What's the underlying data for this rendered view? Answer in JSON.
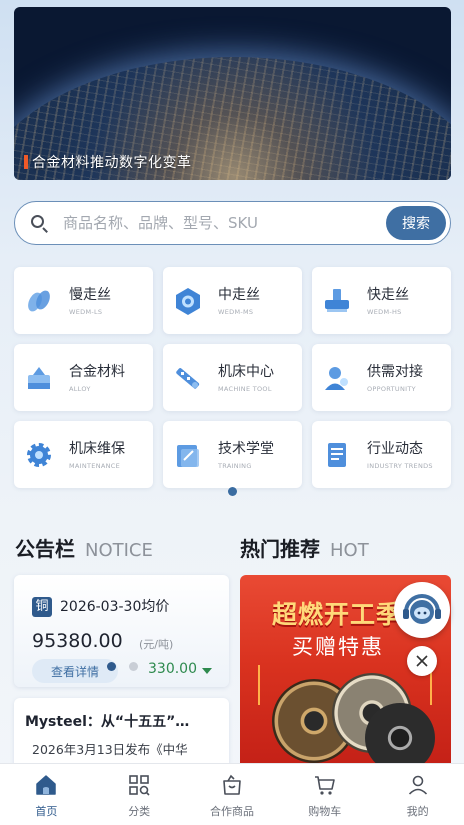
{
  "banner": {
    "caption": "合金材料推动数字化变革"
  },
  "search": {
    "placeholder": "商品名称、品牌、型号、SKU",
    "button_label": "搜索"
  },
  "categories": [
    {
      "title": "慢走丝",
      "subtitle": "WEDM-LS",
      "icon": "slow-wire-icon"
    },
    {
      "title": "中走丝",
      "subtitle": "WEDM-MS",
      "icon": "medium-wire-icon"
    },
    {
      "title": "快走丝",
      "subtitle": "WEDM-HS",
      "icon": "fast-wire-icon"
    },
    {
      "title": "合金材料",
      "subtitle": "ALLOY",
      "icon": "alloy-icon"
    },
    {
      "title": "机床中心",
      "subtitle": "MACHINE TOOL",
      "icon": "machine-tool-icon"
    },
    {
      "title": "供需对接",
      "subtitle": "OPPORTUNITY",
      "icon": "opportunity-icon"
    },
    {
      "title": "机床维保",
      "subtitle": "MAINTENANCE",
      "icon": "maintenance-icon"
    },
    {
      "title": "技术学堂",
      "subtitle": "TRAINING",
      "icon": "training-icon"
    },
    {
      "title": "行业动态",
      "subtitle": "INDUSTRY TRENDS",
      "icon": "industry-trends-icon"
    }
  ],
  "notice": {
    "title": "公告栏",
    "title_en": "NOTICE",
    "badge": "铜",
    "date_label": "2026-03-30均价",
    "price": "95380.00",
    "unit": "(元/吨)",
    "detail_label": "查看详情",
    "change": "330.00",
    "news_title": "Mysteel：从“十五五”…",
    "news_sub": "2026年3月13日发布《中华"
  },
  "hot": {
    "title": "热门推荐",
    "title_en": "HOT",
    "promo_line1": "超燃开工季",
    "promo_line2": "买赠特惠"
  },
  "tabbar": [
    {
      "label": "首页",
      "active": true
    },
    {
      "label": "分类",
      "active": false
    },
    {
      "label": "合作商品",
      "active": false
    },
    {
      "label": "购物车",
      "active": false
    },
    {
      "label": "我的",
      "active": false
    }
  ],
  "colors": {
    "primary": "#3f6fa3",
    "active_tab": "#2f5a8c",
    "promo_red": "#d9321f",
    "change_green": "#2e8a4e"
  }
}
